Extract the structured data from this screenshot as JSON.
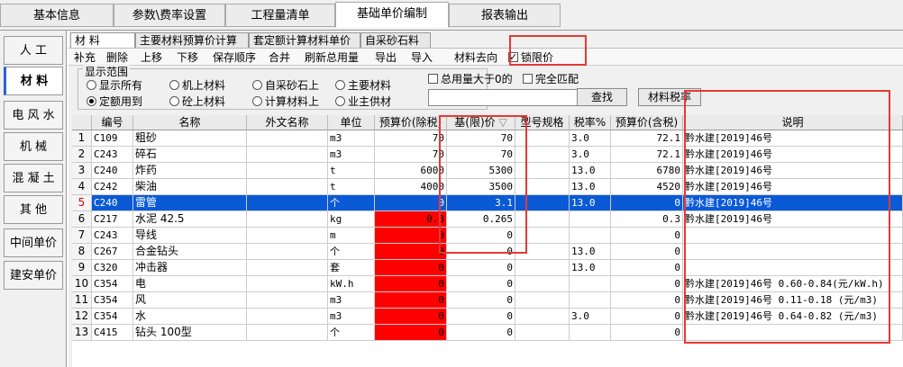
{
  "top_tabs": [
    "基本信息",
    "参数\\费率设置",
    "工程量清单",
    "基础单价编制",
    "报表输出"
  ],
  "side_items": [
    "人  工",
    "材  料",
    "电 风 水",
    "机  械",
    "混 凝 土",
    "其  他",
    "中间单价",
    "建安单价"
  ],
  "sub_tabs": [
    "材  料",
    "主要材料预算价计算",
    "套定额计算材料单价",
    "自采砂石料"
  ],
  "toolbar": {
    "items": [
      "补充",
      "删除",
      "上移",
      "下移",
      "保存顺序",
      "合并",
      "刷新总用量",
      "导出",
      "导入",
      "材料去向"
    ],
    "lock_label": "锁限价",
    "lock_checked": true
  },
  "display_range": {
    "legend": "显示范围",
    "options": [
      {
        "label": "显示所有",
        "selected": false
      },
      {
        "label": "机上材料",
        "selected": false
      },
      {
        "label": "自采砂石上",
        "selected": false
      },
      {
        "label": "主要材料",
        "selected": false
      },
      {
        "label": "定额用到",
        "selected": true
      },
      {
        "label": "砼上材料",
        "selected": false
      },
      {
        "label": "计算材料上",
        "selected": false
      },
      {
        "label": "业主供材",
        "selected": false
      }
    ]
  },
  "filters": {
    "total_gt_zero": "总用量大于0的",
    "exact_match": "完全匹配",
    "search_value": "",
    "find_button": "查找",
    "tax_button": "材料税率"
  },
  "table": {
    "columns": [
      "编号",
      "名称",
      "外文名称",
      "单位",
      "预算价(除税)",
      "基(限)价",
      "型号规格",
      "税率%",
      "预算价(含税)",
      "说明"
    ],
    "sort_indicator": "▽",
    "rows": [
      {
        "no": "1",
        "code": "C109",
        "name": "粗砂",
        "foreign": "",
        "unit": "m3",
        "pre_tax": "70",
        "limit": "70",
        "model": "",
        "tax": "3.0",
        "with_tax": "72.1",
        "note": "黔水建[2019]46号"
      },
      {
        "no": "2",
        "code": "C243",
        "name": "碎石",
        "foreign": "",
        "unit": "m3",
        "pre_tax": "70",
        "limit": "70",
        "model": "",
        "tax": "3.0",
        "with_tax": "72.1",
        "note": "黔水建[2019]46号"
      },
      {
        "no": "3",
        "code": "C240",
        "name": "炸药",
        "foreign": "",
        "unit": "t",
        "pre_tax": "6000",
        "limit": "5300",
        "model": "",
        "tax": "13.0",
        "with_tax": "6780",
        "note": "黔水建[2019]46号"
      },
      {
        "no": "4",
        "code": "C242",
        "name": "柴油",
        "foreign": "",
        "unit": "t",
        "pre_tax": "4000",
        "limit": "3500",
        "model": "",
        "tax": "13.0",
        "with_tax": "4520",
        "note": "黔水建[2019]46号"
      },
      {
        "no": "5",
        "code": "C240",
        "name": "雷管",
        "foreign": "",
        "unit": "个",
        "pre_tax": "0",
        "limit": "3.1",
        "model": "",
        "tax": "13.0",
        "with_tax": "0",
        "note": "黔水建[2019]46号"
      },
      {
        "no": "6",
        "code": "C217",
        "name": "水泥 42.5",
        "foreign": "",
        "unit": "kg",
        "pre_tax": "0.3",
        "limit": "0.265",
        "model": "",
        "tax": "",
        "with_tax": "0.3",
        "note": "黔水建[2019]46号"
      },
      {
        "no": "7",
        "code": "C243",
        "name": "导线",
        "foreign": "",
        "unit": "m",
        "pre_tax": "0",
        "limit": "0",
        "model": "",
        "tax": "",
        "with_tax": "0",
        "note": ""
      },
      {
        "no": "8",
        "code": "C267",
        "name": "合金钻头",
        "foreign": "",
        "unit": "个",
        "pre_tax": "0",
        "limit": "0",
        "model": "",
        "tax": "13.0",
        "with_tax": "0",
        "note": ""
      },
      {
        "no": "9",
        "code": "C320",
        "name": "冲击器",
        "foreign": "",
        "unit": "套",
        "pre_tax": "0",
        "limit": "0",
        "model": "",
        "tax": "13.0",
        "with_tax": "0",
        "note": ""
      },
      {
        "no": "10",
        "code": "C354",
        "name": "电",
        "foreign": "",
        "unit": "kW.h",
        "pre_tax": "0",
        "limit": "0",
        "model": "",
        "tax": "",
        "with_tax": "0",
        "note": "黔水建[2019]46号  0.60-0.84(元/kW.h)"
      },
      {
        "no": "11",
        "code": "C354",
        "name": "风",
        "foreign": "",
        "unit": "m3",
        "pre_tax": "0",
        "limit": "0",
        "model": "",
        "tax": "",
        "with_tax": "0",
        "note": "黔水建[2019]46号  0.11-0.18 (元/m3)"
      },
      {
        "no": "12",
        "code": "C354",
        "name": "水",
        "foreign": "",
        "unit": "m3",
        "pre_tax": "0",
        "limit": "0",
        "model": "",
        "tax": "3.0",
        "with_tax": "0",
        "note": "黔水建[2019]46号  0.64-0.82 (元/m3)"
      },
      {
        "no": "13",
        "code": "C415",
        "name": "钻头 100型",
        "foreign": "",
        "unit": "个",
        "pre_tax": "0",
        "limit": "0",
        "model": "",
        "tax": "",
        "with_tax": "0",
        "note": ""
      }
    ]
  }
}
